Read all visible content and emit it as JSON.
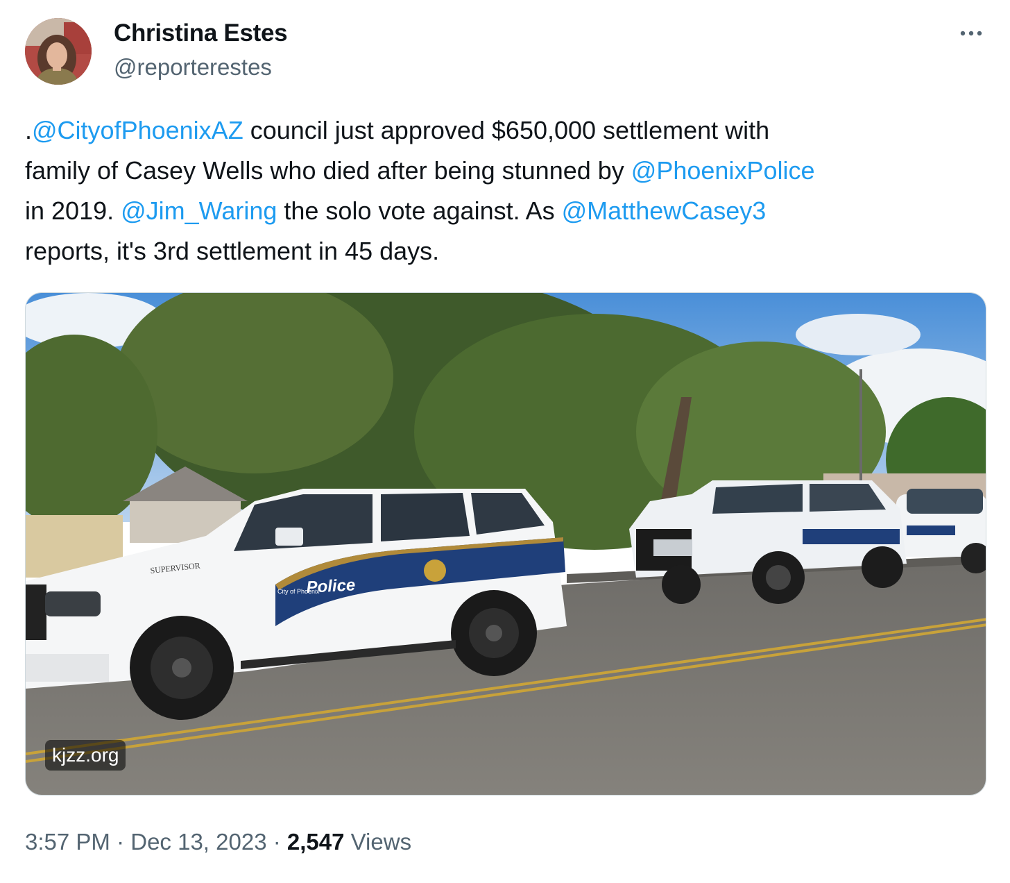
{
  "author": {
    "name": "Christina Estes",
    "handle": "@reporterestes"
  },
  "icons": {
    "avatar": "profile-photo",
    "more": "more-horizontal-icon"
  },
  "tweet": {
    "lines": [
      [
        {
          "text": ".",
          "type": "text"
        },
        {
          "text": "@CityofPhoenixAZ",
          "type": "mention"
        },
        {
          "text": " council just approved $650,000 settlement with",
          "type": "text"
        }
      ],
      [
        {
          "text": "family of Casey Wells who died after being stunned by ",
          "type": "text"
        },
        {
          "text": "@PhoenixPolice",
          "type": "mention"
        }
      ],
      [
        {
          "text": "in 2019. ",
          "type": "text"
        },
        {
          "text": "@Jim_Waring",
          "type": "mention"
        },
        {
          "text": " the solo vote against. As ",
          "type": "text"
        },
        {
          "text": "@MatthewCasey3",
          "type": "mention"
        }
      ],
      [
        {
          "text": "reports, it's 3rd settlement in 45 days.",
          "type": "text"
        }
      ]
    ]
  },
  "media": {
    "domain": "kjzz.org",
    "vehicle_text": {
      "supervisor": "SUPERVISOR",
      "city": "City of Phoenix",
      "police": "Police"
    }
  },
  "meta": {
    "time": "3:57 PM",
    "separator": " · ",
    "date": "Dec 13, 2023",
    "views_count": "2,547",
    "views_label": "Views"
  },
  "colors": {
    "link": "#1d9bf0",
    "text": "#0f1419",
    "secondary": "#536471",
    "border": "#cfd9de"
  }
}
